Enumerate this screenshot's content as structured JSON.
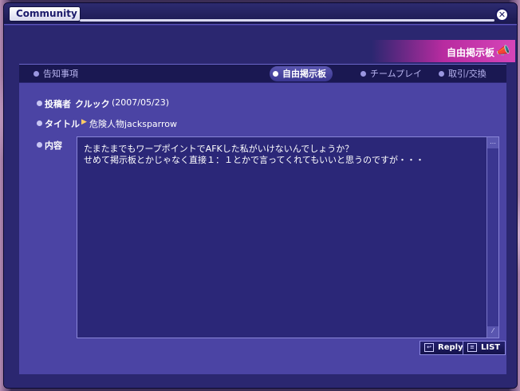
{
  "window": {
    "title": "Community",
    "close_symbol": "✕"
  },
  "banner": {
    "label": "自由掲示板",
    "icon": "megaphone-icon"
  },
  "tabs": [
    {
      "label": "告知事項",
      "active": false
    },
    {
      "label": "自由掲示板",
      "active": true
    },
    {
      "label": "チームプレイ",
      "active": false
    },
    {
      "label": "取引/交換",
      "active": false
    }
  ],
  "post": {
    "author_label": "投稿者",
    "author": "クルック",
    "date": "(2007/05/23)",
    "title_label": "タイトル",
    "title": "危険人物jacksparrow",
    "content_label": "内容",
    "body": "たまたまでもワープポイントでAFKした私がいけないんでしょうか？\nせめて掲示板とかじゃなく直接１：１とかで言ってくれてもいいと思うのですが・・・"
  },
  "buttons": {
    "reply": "Reply",
    "list": "LIST"
  },
  "colors": {
    "panel": "#4b44a4",
    "textbox": "#2b2778",
    "banner_accent": "#d645b8"
  }
}
